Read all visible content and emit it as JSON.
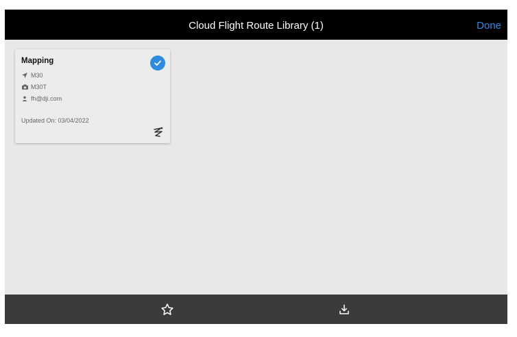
{
  "header": {
    "title": "Cloud Flight Route Library (1)",
    "done_label": "Done"
  },
  "card": {
    "name": "Mapping",
    "aircraft": "M30",
    "camera": "M30T",
    "owner": "fh@dji.com",
    "updated": "Updated On: 03/04/2022",
    "selected": true
  },
  "toolbar": {
    "icons": [
      "star-icon",
      "download-icon"
    ]
  },
  "colors": {
    "accent": "#2f8be0",
    "topbar": "#000000",
    "bottombar": "#3b3b3b",
    "background": "#e8e8e8"
  }
}
